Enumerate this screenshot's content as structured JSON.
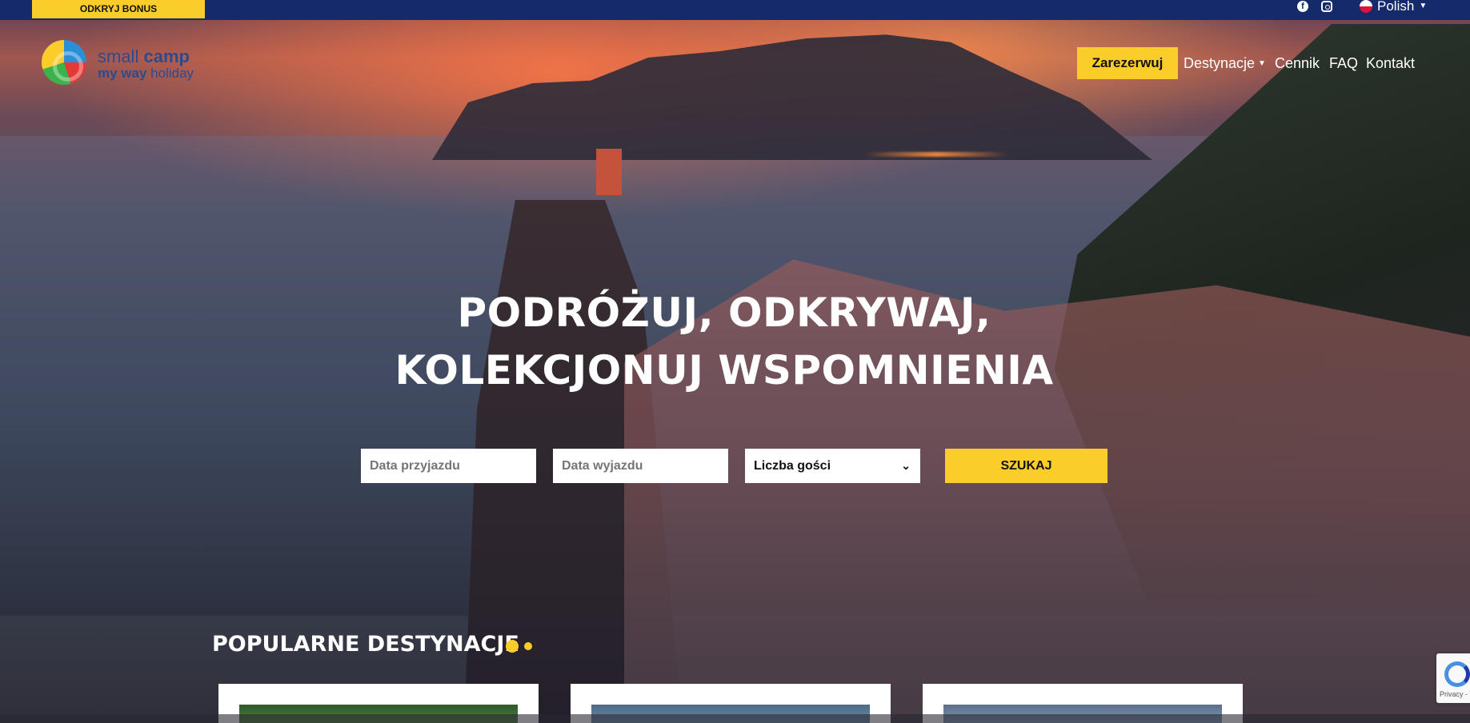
{
  "topbar": {
    "bonus_label": "ODKRYJ BONUS",
    "language_label": "Polish",
    "background_color": "#152a6b"
  },
  "logo": {
    "line1_light": "small",
    "line1_bold": "camp",
    "line2_bold": "my way",
    "line2_light": "holiday"
  },
  "nav": {
    "book_label": "Zarezerwuj",
    "items": [
      {
        "label": "Destynacje"
      },
      {
        "label": "Cennik"
      },
      {
        "label": "FAQ"
      },
      {
        "label": "Kontakt"
      }
    ]
  },
  "hero": {
    "headline_line1": "PODRÓŻUJ, ODKRYWAJ,",
    "headline_line2": "KOLEKCJONUJ WSPOMNIENIA"
  },
  "search": {
    "arrival_placeholder": "Data przyjazdu",
    "departure_placeholder": "Data wyjazdu",
    "guests_selected": "Liczba gości",
    "submit_label": "SZUKAJ"
  },
  "popular": {
    "title": "POPULARNE DESTYNACJE"
  },
  "recaptcha": {
    "label": "Privacy - T"
  },
  "colors": {
    "accent": "#fbcd2b",
    "brand": "#2e4a8e"
  }
}
